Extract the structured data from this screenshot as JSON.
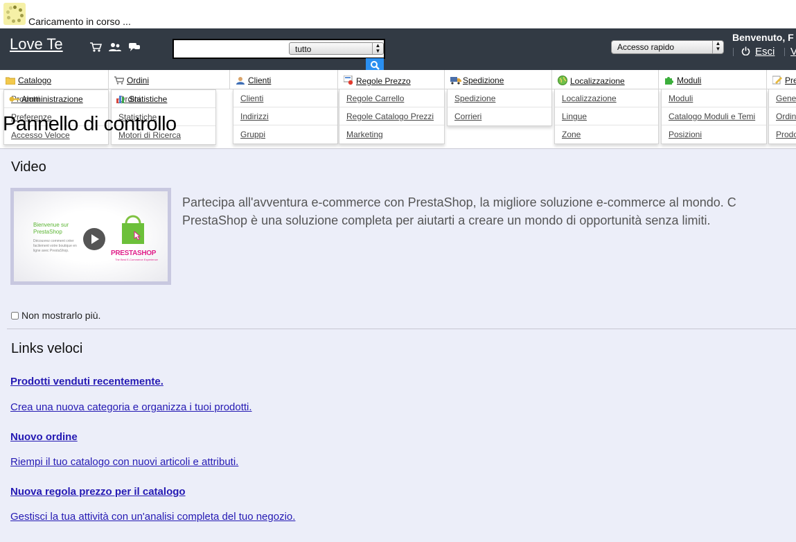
{
  "loading": {
    "text": "Caricamento in corso ..."
  },
  "header": {
    "shop_name": "Love Te",
    "search_select": "tutto",
    "quick_access": "Accesso rapido",
    "welcome": "Benvenuto, F",
    "logout": "Esci",
    "trailing": "V"
  },
  "tabs": [
    {
      "label": "Catalogo",
      "icon": "folder-icon"
    },
    {
      "label": "Ordini",
      "icon": "cart-icon"
    },
    {
      "label": "Clienti",
      "icon": "user-icon"
    },
    {
      "label": "Regole Prezzo",
      "icon": "price-rule-icon"
    },
    {
      "label": "Spedizione",
      "icon": "truck-icon"
    },
    {
      "label": "Localizzazione",
      "icon": "globe-icon"
    },
    {
      "label": "Moduli",
      "icon": "puzzle-icon"
    },
    {
      "label": "Pre",
      "icon": "preferences-icon"
    }
  ],
  "second_row_tabs": [
    {
      "label": "Amministrazione",
      "icon": "key-icon"
    },
    {
      "label": "Statistiche",
      "icon": "stats-icon"
    }
  ],
  "submenus": {
    "catalogo": [
      "Prodotti",
      "Preferenze",
      "Accesso Veloce"
    ],
    "ordini": [
      "Ordini",
      "Statistiche",
      "Motori di Ricerca"
    ],
    "clienti": [
      "Clienti",
      "Indirizzi",
      "Gruppi"
    ],
    "regole": [
      "Regole Carrello",
      "Regole Catalogo Prezzi",
      "Marketing"
    ],
    "spedizione": [
      "Spedizione",
      "Corrieri"
    ],
    "localizzazione": [
      "Localizzazione",
      "Lingue",
      "Zone"
    ],
    "moduli": [
      "Moduli",
      "Catalogo Moduli e Temi",
      "Posizioni"
    ],
    "preferenze": [
      "Gene",
      "Ordin",
      "Prodo"
    ]
  },
  "page": {
    "title": "Pannello di controllo",
    "video_heading": "Video",
    "video_line1": "Partecipa all'avventura e-commerce con PrestaShop, la migliore soluzione e-commerce al mondo. C",
    "video_line2": "PrestaShop è una soluzione completa per aiutarti a creare un mondo di opportunità senza limiti.",
    "video_thumb": {
      "welcome_line1": "Bienvenue sur",
      "welcome_line2": "PrestaShop",
      "desc": "Découvrez comment créer facilement votre boutique en ligne avec PrestaShop.",
      "logo": "PRESTASHOP",
      "tagline": "The Best E-Commerce Experience"
    },
    "dont_show": "Non mostrarlo più.",
    "links_heading": "Links veloci",
    "links": [
      {
        "label": "Prodotti venduti recentemente.",
        "bold": true
      },
      {
        "label": "Crea una nuova categoria e organizza i tuoi prodotti.",
        "bold": false
      },
      {
        "label": "Nuovo ordine",
        "bold": true
      },
      {
        "label": "Riempi il tuo catalogo con nuovi articoli e attributi.",
        "bold": false
      },
      {
        "label": "Nuova regola prezzo per il catalogo",
        "bold": true
      },
      {
        "label": "Gestisci la tua attività con un'analisi completa del tuo negozio.",
        "bold": false
      }
    ]
  },
  "colors": {
    "header_bg": "#323a44",
    "content_bg": "#eceef9",
    "link": "#2419b3",
    "search_btn": "#2a8ff0"
  }
}
